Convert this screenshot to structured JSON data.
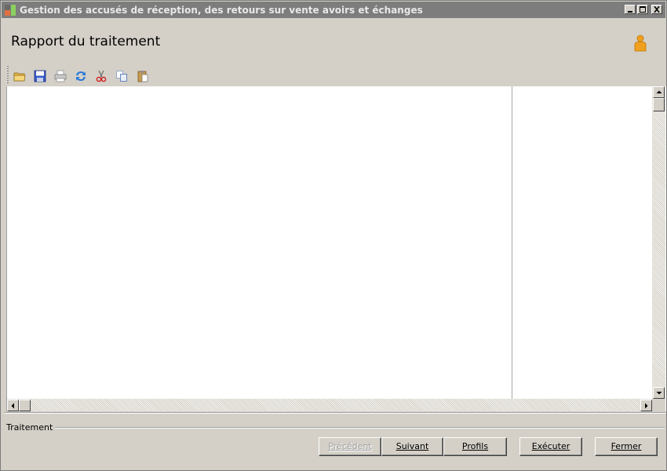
{
  "window": {
    "title": "Gestion des accusés de réception, des retours sur vente avoirs et échanges",
    "buttons": [
      "minimize",
      "maximize",
      "close"
    ]
  },
  "header": {
    "title": "Rapport du traitement",
    "user_icon": "user-icon"
  },
  "toolbar": {
    "items": [
      "open-folder-icon",
      "save-icon",
      "print-icon",
      "refresh-icon",
      "cut-icon",
      "copy-icon",
      "paste-icon"
    ]
  },
  "status": {
    "group_label": "Traitement"
  },
  "actions": {
    "previous": {
      "label": "Précédent",
      "enabled": false
    },
    "next": {
      "label": "Suivant",
      "enabled": true
    },
    "profiles": {
      "label": "Profils",
      "enabled": true
    },
    "execute": {
      "label": "Exécuter",
      "enabled": true
    },
    "close": {
      "label": "Fermer",
      "enabled": true
    }
  },
  "colors": {
    "titlebar": "#7d7d7d",
    "face": "#d4d0c8",
    "user_icon": "#f0a020"
  }
}
